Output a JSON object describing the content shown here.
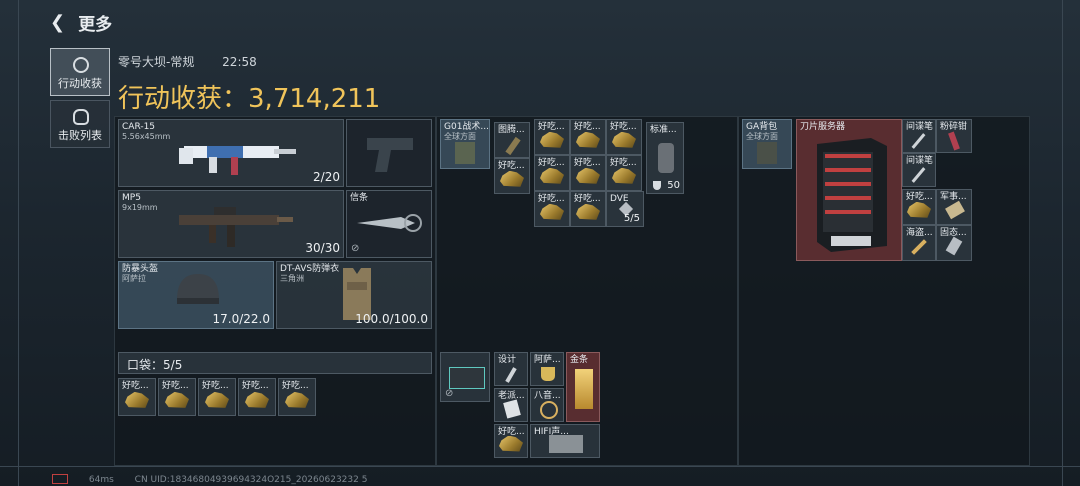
{
  "header": {
    "back_label": "更多"
  },
  "nav": [
    {
      "label": "行动收获",
      "icon": "target-icon"
    },
    {
      "label": "击败列表",
      "icon": "skull-icon"
    }
  ],
  "match": {
    "map": "零号大坝-常规",
    "time": "22:58"
  },
  "haul": {
    "label": "行动收获：",
    "value": "3,714,211"
  },
  "loadout": {
    "primary": {
      "name": "CAR-15",
      "caliber": "5.56x45mm",
      "ammo": "2/20"
    },
    "secondary": {
      "name": "MP5",
      "caliber": "9x19mm",
      "ammo": "30/30"
    },
    "melee": {
      "name": "信条"
    },
    "helmet": {
      "name": "防暴头盔",
      "origin": "阿萨拉",
      "durability": "17.0/22.0"
    },
    "armor": {
      "name": "DT-AVS防弹衣",
      "origin": "三角洲",
      "durability": "100.0/100.0"
    }
  },
  "pocket": {
    "label": "口袋：",
    "count": "5/5",
    "items": [
      "好吃...",
      "好吃...",
      "好吃...",
      "好吃...",
      "好吃..."
    ]
  },
  "chest_rig": {
    "name": "G01战术...",
    "sub": "全球方面",
    "items": [
      "图腾...",
      "好吃...",
      "好吃...",
      "好吃...",
      "好吃...",
      "好吃...",
      "好吃...",
      "好吃...",
      "好吃...",
      "好吃...",
      "DVE"
    ],
    "dve_count": "5/5",
    "standard": {
      "label": "标准...",
      "count": "50"
    }
  },
  "backpack": {
    "items": [
      "设计",
      "阿萨...",
      "金条",
      "老派...",
      "八音...",
      "好吃...",
      "HIFI声..."
    ]
  },
  "container": {
    "name": "GA背包",
    "sub": "全球方面",
    "server": "刀片服务器",
    "items": [
      "间谍笔",
      "粉碎钳",
      "间谍笔",
      "好吃...",
      "军事...",
      "海盗...",
      "固态..."
    ]
  },
  "footer": {
    "ping": "64ms",
    "uid": "CN UID:18346804939694324O215_20260623232 5"
  }
}
